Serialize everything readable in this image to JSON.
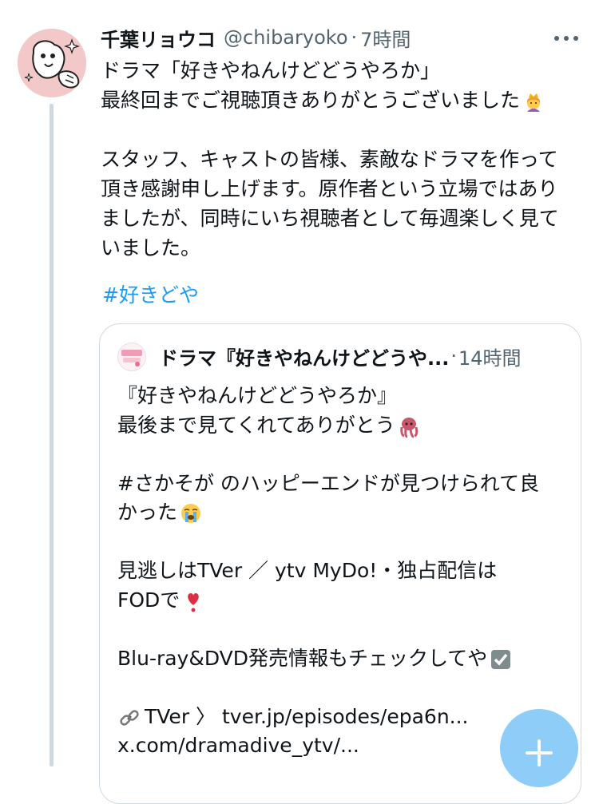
{
  "tweet": {
    "author_name": "千葉リョウコ",
    "handle": "@chibaryoko",
    "separator": "·",
    "time": "7時間",
    "lines": [
      "ドラマ「好きやねんけどどうやろか」",
      "最終回までご視聴頂きありがとうございました",
      "",
      "スタッフ、キャストの皆様、素敵なドラマを作って",
      "頂き感謝申し上げます。原作者という立場ではあり",
      "ましたが、同時にいち視聴者として毎週楽しく見て",
      "いました。"
    ],
    "hashtag": "#好きどや"
  },
  "quote": {
    "author_name": "ドラマ『好きやねんけどどうや...",
    "separator": "·",
    "time": "14時間",
    "lines": [
      "『好きやねんけどどうやろか』",
      "最後まで見てくれてありがとう",
      "",
      "#さかそが のハッピーエンドが見つけられて良",
      "かった",
      "",
      "見逃しはTVer ／ ytv MyDo!・独占配信は",
      "FODで",
      "",
      "Blu-ray&DVD発売情報もチェックしてや",
      "",
      "TVer 〉 tver.jp/episodes/epa6n...",
      "x.com/dramadive_ytv/..."
    ]
  },
  "icons": {
    "more": "more-icon",
    "compose": "compose-plus-icon"
  }
}
